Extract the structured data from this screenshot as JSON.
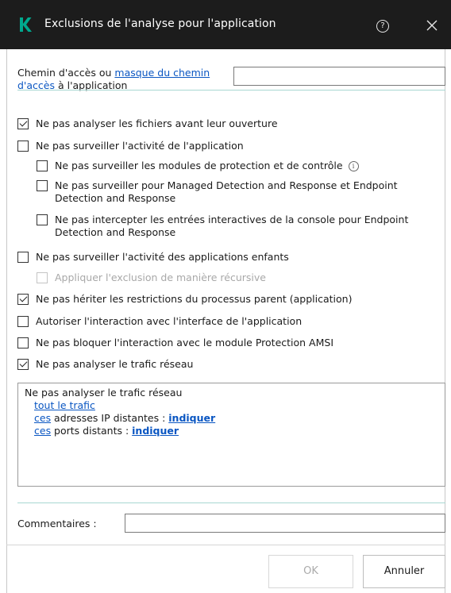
{
  "window": {
    "title": "Exclusions de l'analyse pour l'application",
    "brand_color": "#00a88e",
    "help_label": "?"
  },
  "path": {
    "label_prefix": "Chemin d'accès ou ",
    "label_link": "masque du chemin d'accès",
    "label_suffix": " à l'application",
    "value": ""
  },
  "options": [
    {
      "label": "Ne pas analyser les fichiers avant leur ouverture",
      "checked": true,
      "disabled": false
    },
    {
      "label": "Ne pas surveiller l'activité de l'application",
      "checked": false,
      "disabled": false
    },
    {
      "label": "Ne pas surveiller les modules de protection et de contrôle",
      "checked": false,
      "disabled": false,
      "info": true
    },
    {
      "label": "Ne pas surveiller pour Managed Detection and Response et Endpoint Detection and Response",
      "checked": false,
      "disabled": false
    },
    {
      "label": "Ne pas intercepter les entrées interactives de la console pour Endpoint Detection and Response",
      "checked": false,
      "disabled": false
    },
    {
      "label": "Ne pas surveiller l'activité des applications enfants",
      "checked": false,
      "disabled": false
    },
    {
      "label": "Appliquer l'exclusion de manière récursive",
      "checked": false,
      "disabled": true
    },
    {
      "label": "Ne pas hériter les restrictions du processus parent (application)",
      "checked": true,
      "disabled": false
    },
    {
      "label": "Autoriser l'interaction avec l'interface de l'application",
      "checked": false,
      "disabled": false
    },
    {
      "label": "Ne pas bloquer l'interaction avec le module Protection AMSI",
      "checked": false,
      "disabled": false
    },
    {
      "label": "Ne pas analyser le trafic réseau",
      "checked": true,
      "disabled": false
    }
  ],
  "traffic": {
    "heading": "Ne pas analyser le trafic réseau",
    "all_traffic_link": "tout le trafic",
    "ip_link": "ces",
    "ip_text": " adresses IP distantes : ",
    "ip_specify": "indiquer",
    "ports_link": "ces",
    "ports_text": " ports distants : ",
    "ports_specify": "indiquer"
  },
  "comments": {
    "label": "Commentaires :",
    "value": ""
  },
  "buttons": {
    "ok": "OK",
    "cancel": "Annuler"
  }
}
